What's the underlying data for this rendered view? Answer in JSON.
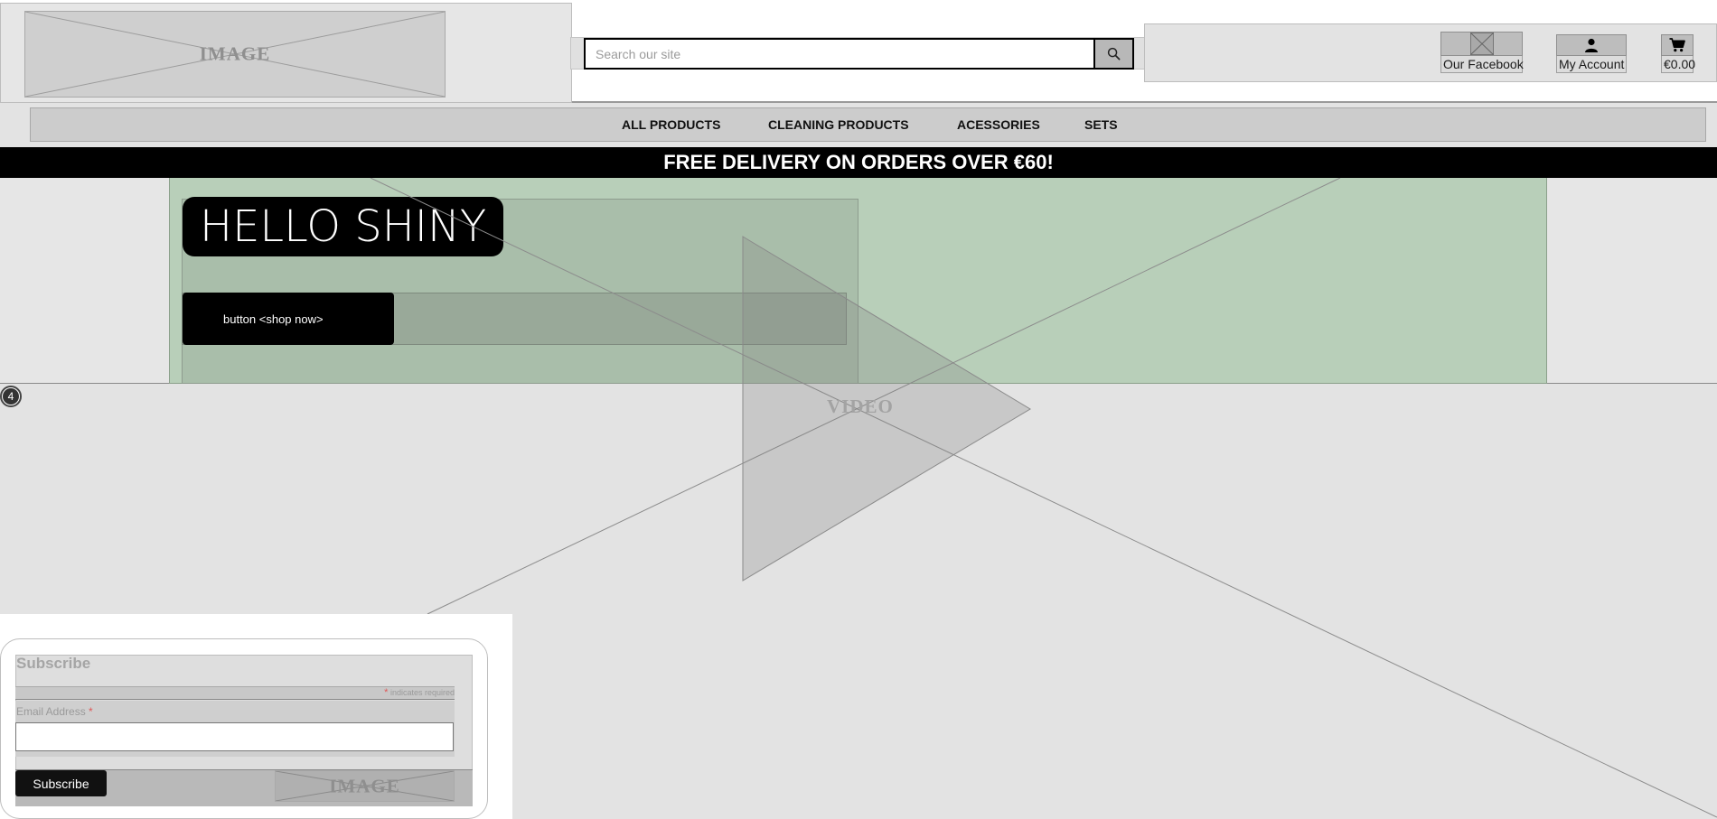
{
  "header": {
    "logo_placeholder_label": "IMAGE",
    "search": {
      "placeholder": "Search our site",
      "value": ""
    },
    "icons": {
      "search": "search-icon",
      "facebook": "facebook-image-icon",
      "account": "user-icon",
      "cart": "cart-icon"
    },
    "facebook_label": "Our Facebook",
    "account_label": "My Account",
    "cart_total": "€0.00"
  },
  "nav": {
    "items": [
      {
        "label": "ALL PRODUCTS"
      },
      {
        "label": "CLEANING PRODUCTS"
      },
      {
        "label": "ACESSORIES"
      },
      {
        "label": "SETS"
      }
    ]
  },
  "promo": {
    "text": "FREE DELIVERY ON ORDERS OVER €60!"
  },
  "hero": {
    "title": "HELLO SHINY",
    "cta_label": "button <shop now>",
    "background_color": "#b8cfb9"
  },
  "video": {
    "placeholder_label": "VIDEO"
  },
  "badge": {
    "value": "4"
  },
  "subscribe": {
    "title": "Subscribe",
    "required_note": "indicates required",
    "required_marker": "*",
    "email_label": "Email Address",
    "email_value": "",
    "button_label": "Subscribe",
    "image_placeholder_label": "IMAGE"
  }
}
